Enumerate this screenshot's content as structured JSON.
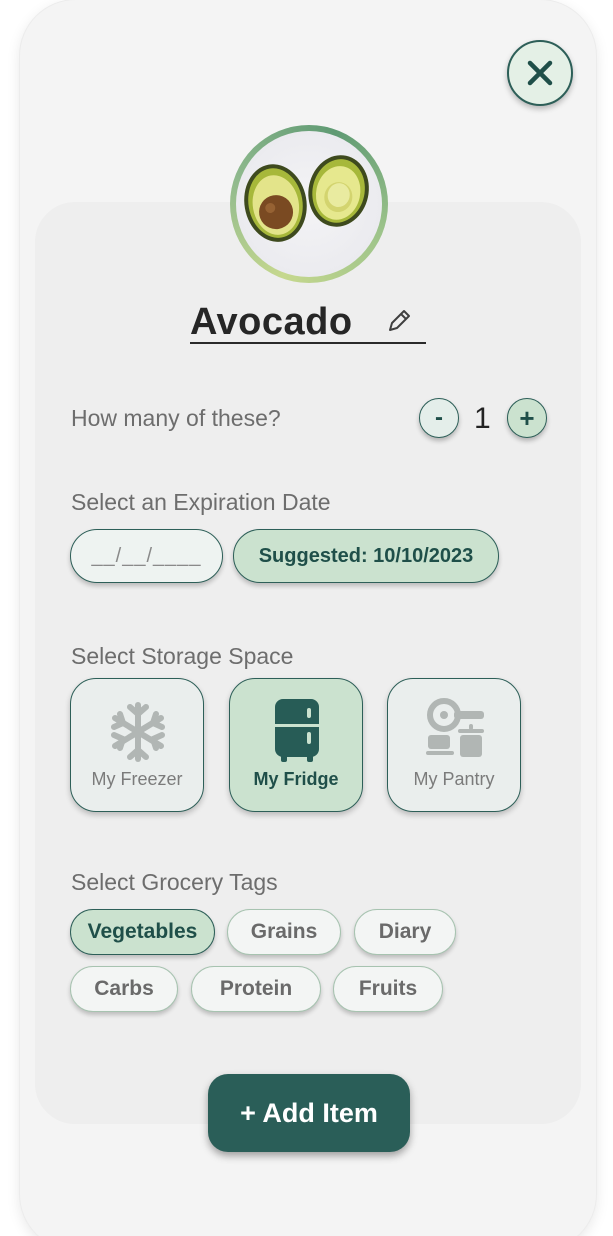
{
  "item": {
    "name": "Avocado",
    "photo_alt": "avocado-photo"
  },
  "quantity": {
    "label": "How many of these?",
    "minus": "-",
    "value": "1",
    "plus": "+"
  },
  "expiration": {
    "label": "Select an Expiration Date",
    "placeholder": "__/__/____",
    "suggested": "Suggested: 10/10/2023"
  },
  "storage": {
    "label": "Select Storage Space",
    "options": [
      {
        "label": "My Freezer",
        "icon": "snowflake-icon",
        "selected": false
      },
      {
        "label": "My Fridge",
        "icon": "fridge-icon",
        "selected": true
      },
      {
        "label": "My Pantry",
        "icon": "pantry-icon",
        "selected": false
      }
    ]
  },
  "tags": {
    "label": "Select Grocery Tags",
    "items": [
      {
        "label": "Vegetables",
        "selected": true
      },
      {
        "label": "Grains",
        "selected": false
      },
      {
        "label": "Diary",
        "selected": false
      },
      {
        "label": "Carbs",
        "selected": false
      },
      {
        "label": "Protein",
        "selected": false
      },
      {
        "label": "Fruits",
        "selected": false
      }
    ]
  },
  "actions": {
    "add_item": "+ Add Item",
    "close": "close-icon",
    "edit": "pencil-icon"
  },
  "colors": {
    "primary": "#2a5e58",
    "selected_fill": "#cbe2cf",
    "panel": "#eeeeee",
    "card": "#f4f4f4"
  }
}
